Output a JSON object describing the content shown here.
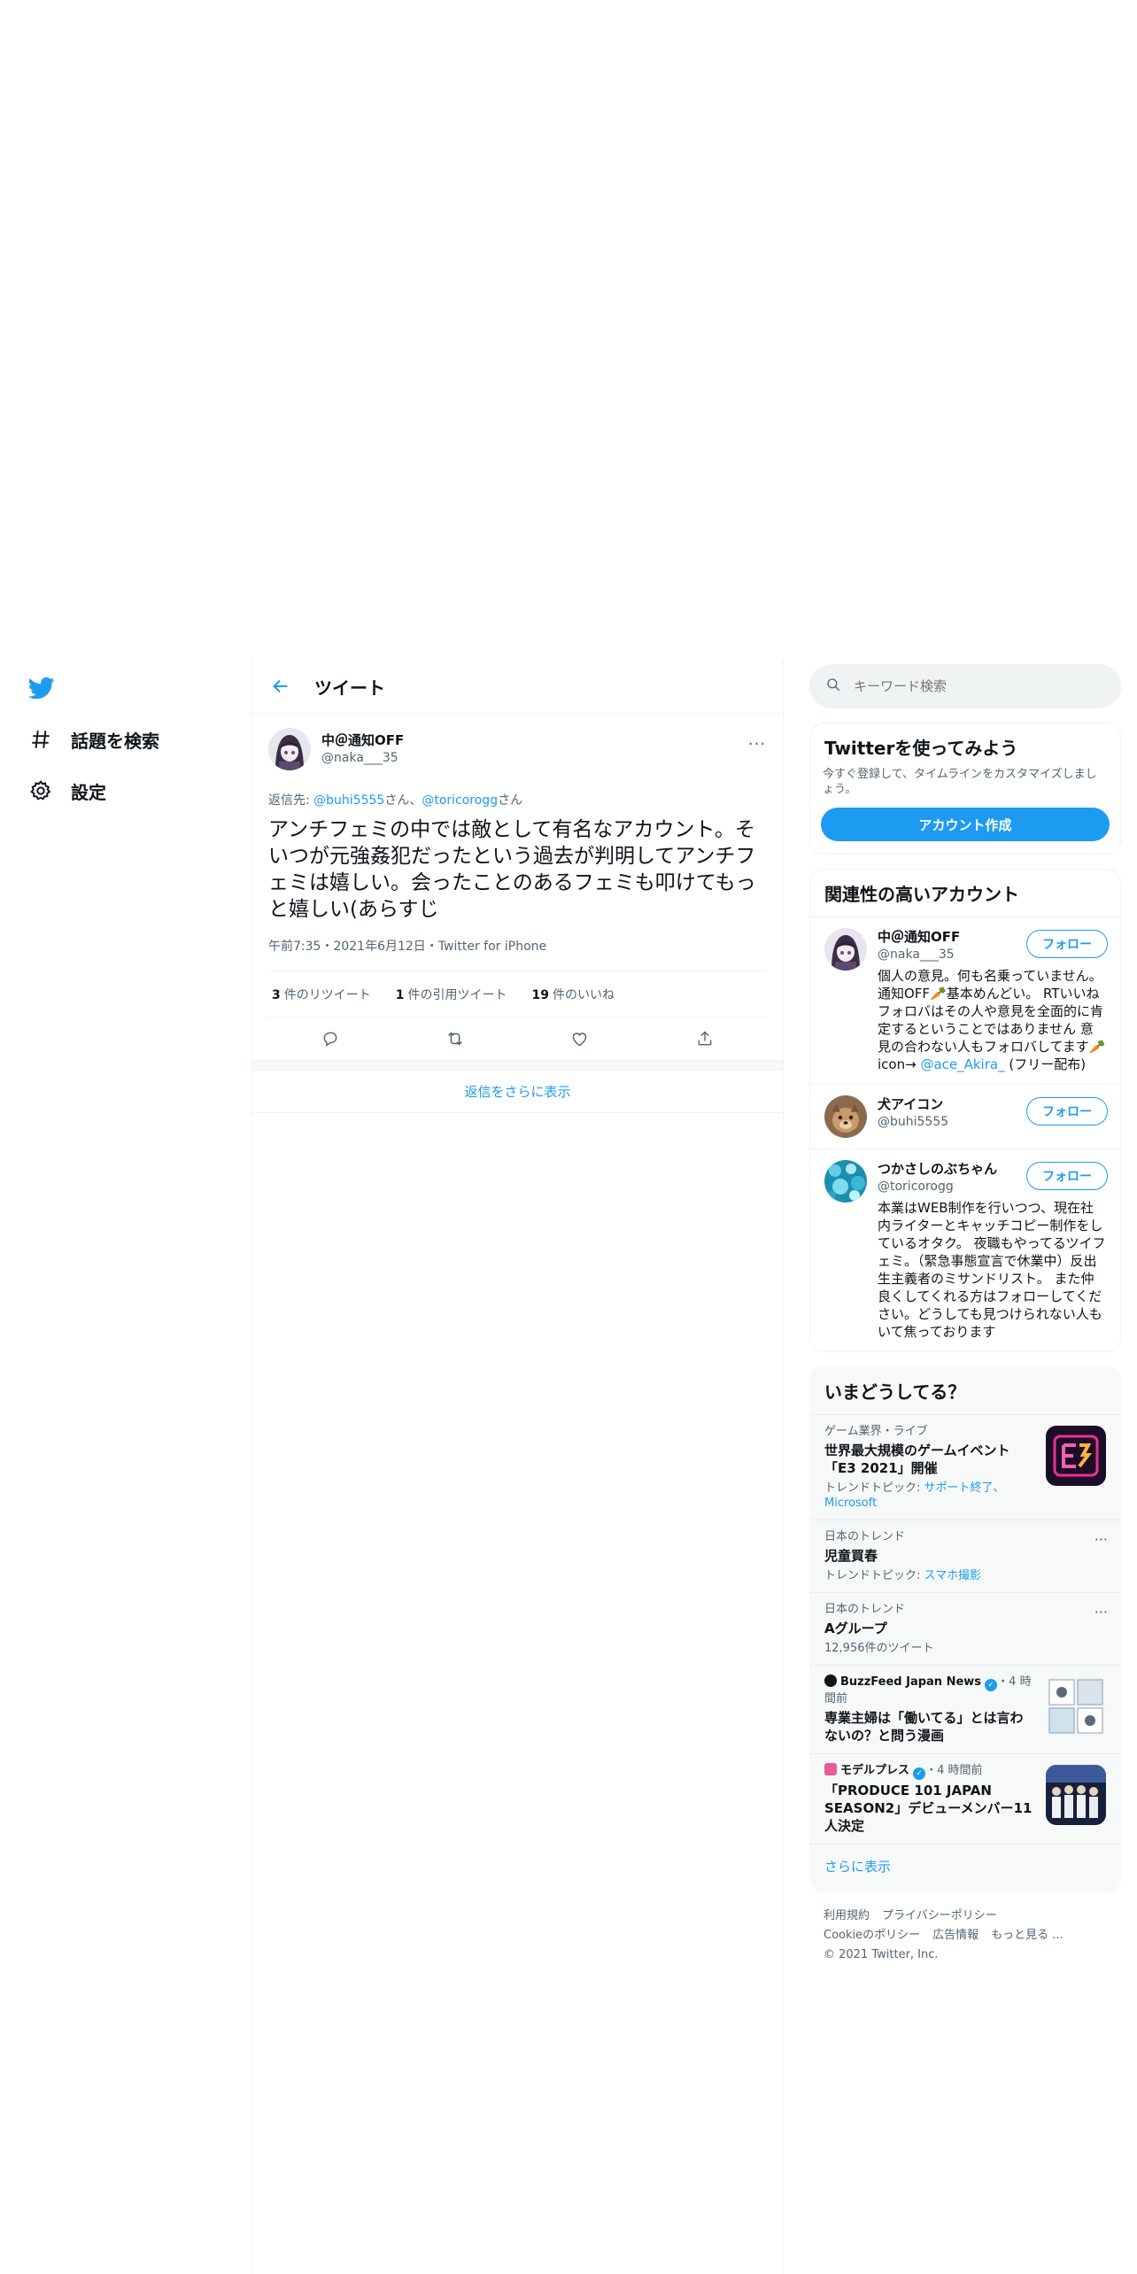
{
  "nav": {
    "explore_label": "話題を検索",
    "settings_label": "設定"
  },
  "header": {
    "title": "ツイート"
  },
  "tweet": {
    "display_name": "中＠通知OFF",
    "handle": "@naka___35",
    "reply_prefix": "返信先: ",
    "reply_user1": "@buhi5555",
    "reply_san1": "さん、",
    "reply_user2": "@toricorogg",
    "reply_san2": "さん",
    "text": "アンチフェミの中では敵として有名なアカウント。そいつが元強姦犯だったという過去が判明してアンチフェミは嬉しい。会ったことのあるフェミも叩けてもっと嬉しい(あらすじ",
    "meta": "午前7:35・2021年6月12日・Twitter for iPhone",
    "retweets_count": "3",
    "retweets_label": "件のリツイート",
    "quotes_count": "1",
    "quotes_label": "件の引用ツイート",
    "likes_count": "19",
    "likes_label": "件のいいね",
    "more_icon": "..."
  },
  "show_more_replies": "返信をさらに表示",
  "search": {
    "placeholder": "キーワード検索"
  },
  "signup": {
    "title": "Twitterを使ってみよう",
    "text": "今すぐ登録して、タイムラインをカスタマイズしましょう。",
    "button": "アカウント作成"
  },
  "related": {
    "title": "関連性の高いアカウント",
    "follow_label": "フォロー",
    "accounts": [
      {
        "name": "中＠通知OFF",
        "handle": "@naka___35",
        "bio": "個人の意見。何も名乗っていません。通知OFF🥕基本めんどい。 RTいいねフォロバはその人や意見を全面的に肯定するということではありません 意見の合わない人もフォロバしてます🥕icon→ ",
        "bio_link": "@ace_Akira_",
        "bio_tail": " (フリー配布)"
      },
      {
        "name": "犬アイコン",
        "handle": "@buhi5555",
        "bio": "",
        "bio_link": "",
        "bio_tail": ""
      },
      {
        "name": "つかさしのぶちゃん",
        "handle": "@toricorogg",
        "bio": "本業はWEB制作を行いつつ、現在社内ライターとキャッチコピー制作をしているオタク。 夜職もやってるツイフェミ。（緊急事態宣言で休業中）反出生主義者のミサンドリスト。 また仲良くしてくれる方はフォローしてください。どうしても見つけられない人もいて焦っております",
        "bio_link": "",
        "bio_tail": ""
      }
    ]
  },
  "trends": {
    "title": "いまどうしてる？",
    "items": [
      {
        "meta": "ゲーム業界・ライブ",
        "title": "世界最大規模のゲームイベント「E3 2021」開催",
        "sub_prefix": "トレンドトピック: ",
        "sub_link": "サポート終了、Microsoft"
      },
      {
        "meta": "日本のトレンド",
        "title": "児童買春",
        "sub_prefix": "トレンドトピック: ",
        "sub_link": "スマホ撮影"
      },
      {
        "meta": "日本のトレンド",
        "title": "Aグループ",
        "sub_prefix": "12,956件のツイート",
        "sub_link": ""
      },
      {
        "source": "BuzzFeed Japan News",
        "time": "・4 時間前",
        "title": "専業主婦は「働いてる」とは言わないの？と問う漫画"
      },
      {
        "source": "モデルプレス",
        "time": "・4 時間前",
        "title": "「PRODUCE 101 JAPAN SEASON2」デビューメンバー11人決定"
      }
    ],
    "show_more": "さらに表示"
  },
  "footer": {
    "links": [
      "利用規約",
      "プライバシーポリシー",
      "Cookieのポリシー",
      "広告情報",
      "もっと見る ..."
    ],
    "copyright": "© 2021 Twitter, Inc."
  },
  "colors": {
    "accent": "#1d9bf0",
    "text": "#0f1419",
    "muted": "#536471",
    "border": "#eff3f4"
  }
}
